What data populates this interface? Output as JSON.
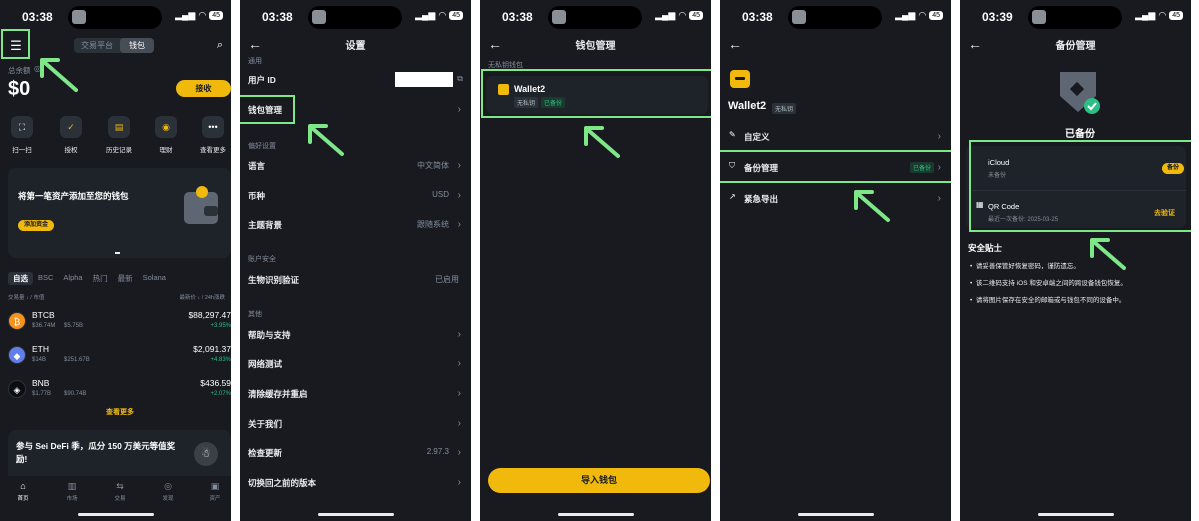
{
  "status": [
    {
      "time": "03:38",
      "battery": "45"
    },
    {
      "time": "03:38",
      "battery": "45"
    },
    {
      "time": "03:38",
      "battery": "45"
    },
    {
      "time": "03:38",
      "battery": "45"
    },
    {
      "time": "03:39",
      "battery": "45"
    }
  ],
  "home": {
    "tabs": [
      "交易平台",
      "钱包"
    ],
    "balance_label": "总余额",
    "balance": "$0",
    "receive_btn": "接收",
    "quick_actions": [
      "扫一扫",
      "授权",
      "历史记录",
      "理财",
      "查看更多"
    ],
    "promo_title": "将第一笔资产添加至您的钱包",
    "promo_btn": "添加资金",
    "market_tabs": [
      "自选",
      "BSC",
      "Alpha",
      "热门",
      "最新",
      "Solana"
    ],
    "list_header_left": "交易量 ↓ / 市值",
    "list_header_right": "最新价 ↓ / 24h涨跌",
    "coins": [
      {
        "symbol": "BTCB",
        "vol": "$36.74M",
        "cap": "$5.75B",
        "price": "$88,297.47",
        "change": "+3.95%",
        "color": "#f7931a",
        "glyph": "₿"
      },
      {
        "symbol": "ETH",
        "vol": "$14B",
        "cap": "$251.67B",
        "price": "$2,091.37",
        "change": "+4.83%",
        "color": "#627eea",
        "glyph": "◆"
      },
      {
        "symbol": "BNB",
        "vol": "$1.77B",
        "cap": "$90.74B",
        "price": "$436.59",
        "change": "+2.07%",
        "color": "#0b0e11",
        "glyph": "◈"
      }
    ],
    "see_more": "查看更多",
    "campaign": "参与 Sei DeFi 季，瓜分 150 万美元等值奖励!",
    "bottom_nav": [
      "首页",
      "市场",
      "交易",
      "发现",
      "资产"
    ]
  },
  "settings": {
    "title": "设置",
    "general": "通用",
    "user_id": "用户 ID",
    "wallet_mgmt": "钱包管理",
    "prefs": "偏好设置",
    "language": "语言",
    "language_val": "中文简体",
    "currency": "币种",
    "currency_val": "USD",
    "theme": "主题背景",
    "theme_val": "跟随系统",
    "security": "账户安全",
    "biometric": "生物识别验证",
    "biometric_val": "已启用",
    "other": "其他",
    "help": "帮助与支持",
    "network": "网络测试",
    "clear_cache": "清除缓存并重启",
    "about": "关于我们",
    "update": "检查更新",
    "version": "2.97.3",
    "switch_version": "切换回之前的版本"
  },
  "wallet_list": {
    "title": "钱包管理",
    "section": "无私钥钱包",
    "wallet_name": "Wallet2",
    "tag1": "无私钥",
    "tag2": "已备份",
    "import_btn": "导入钱包"
  },
  "wallet_detail": {
    "name": "Wallet2",
    "tag": "无私钥",
    "customize": "自定义",
    "backup": "备份管理",
    "backup_status": "已备份",
    "export": "紧急导出"
  },
  "backup": {
    "title": "备份管理",
    "status": "已备份",
    "icloud": "iCloud",
    "icloud_sub": "未备份",
    "icloud_btn": "备份",
    "qr": "QR Code",
    "qr_sub": "最近一次备份: 2025-03-25",
    "qr_btn": "去验证",
    "tips_title": "安全贴士",
    "tips": [
      "请妥善保管好恢复密码，谨防遗忘。",
      "该二维码支持 iOS 和安卓端之间的跨设备钱包恢复。",
      "请将图片保存在安全的邮箱或与钱包不同的设备中。"
    ]
  }
}
